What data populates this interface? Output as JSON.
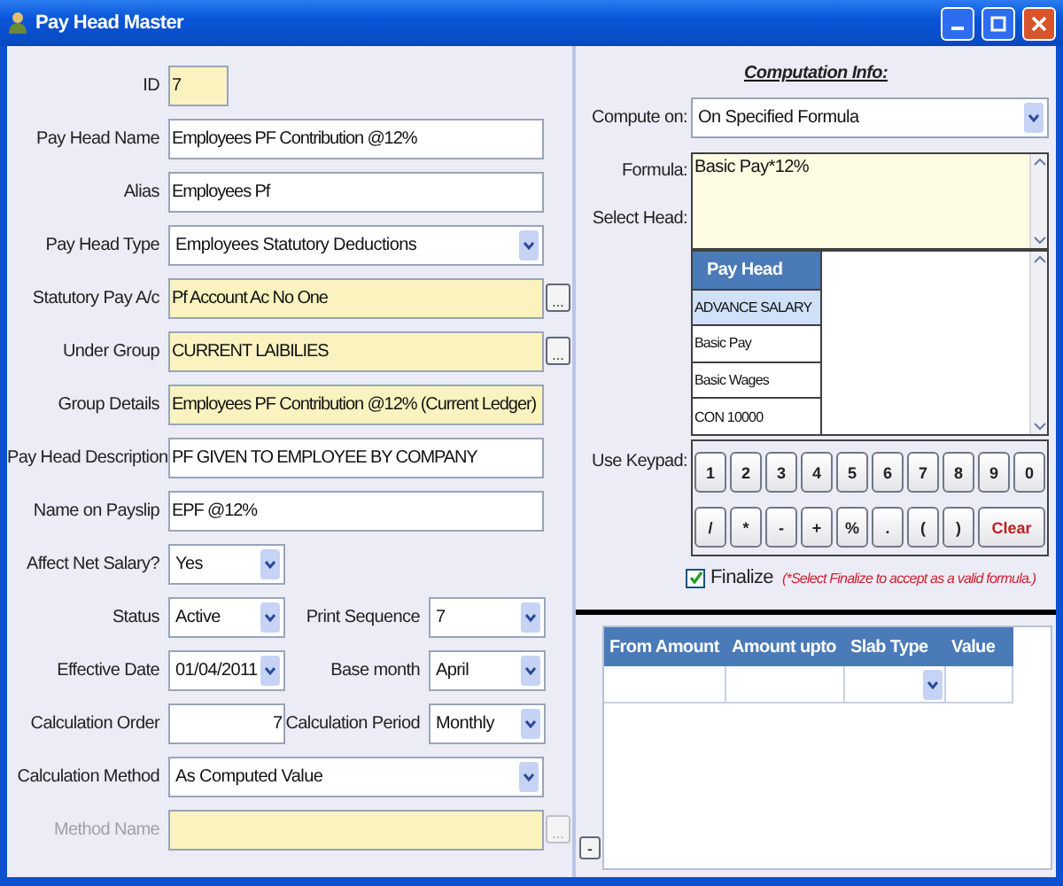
{
  "window": {
    "title": "Pay Head Master"
  },
  "fields": [
    {
      "kind": "short-text",
      "label": "ID",
      "value": "7",
      "highlighted": true
    },
    {
      "kind": "text",
      "label": "Pay Head Name",
      "value": "Employees PF Contribution @12%",
      "highlighted": false
    },
    {
      "kind": "text",
      "label": "Alias",
      "value": "Employees Pf",
      "highlighted": false
    },
    {
      "kind": "select",
      "label": "Pay Head Type",
      "value": "Employees Statutory Deductions",
      "highlighted": false
    },
    {
      "kind": "lookup",
      "label": "Statutory Pay A/c",
      "value": "Pf Account Ac No One",
      "highlighted": true,
      "button": "...",
      "disabled": false
    },
    {
      "kind": "lookup",
      "label": "Under Group",
      "value": "CURRENT LAIBILIES",
      "highlighted": true,
      "button": "...",
      "disabled": false
    },
    {
      "kind": "text",
      "label": "Group Details",
      "value": "Employees PF Contribution @12% (Current Ledger)",
      "highlighted": true
    },
    {
      "kind": "text",
      "label": "Pay Head Description",
      "value": "PF GIVEN TO EMPLOYEE BY COMPANY",
      "highlighted": false
    },
    {
      "kind": "text",
      "label": "Name on Payslip",
      "value": "EPF @12%",
      "highlighted": false
    },
    {
      "kind": "short-select",
      "label": "Affect Net Salary?",
      "value": "Yes",
      "highlighted": false
    },
    {
      "kind": "pair",
      "left": {
        "kind": "short-select",
        "label": "Status",
        "value": "Active"
      },
      "right": {
        "kind": "short-select",
        "label": "Print Sequence",
        "value": "7"
      }
    },
    {
      "kind": "pair",
      "left": {
        "kind": "short-select",
        "label": "Effective Date",
        "value": "01/04/2011"
      },
      "right": {
        "kind": "short-select",
        "label": "Base month",
        "value": "April"
      }
    },
    {
      "kind": "pair",
      "left": {
        "kind": "short-number",
        "label": "Calculation Order",
        "value": "7"
      },
      "right": {
        "kind": "short-select",
        "label": "Calculation Period",
        "value": "Monthly"
      }
    },
    {
      "kind": "select",
      "label": "Calculation Method",
      "value": "As Computed Value",
      "highlighted": false
    },
    {
      "kind": "lookup",
      "label": "Method Name",
      "highlighted": true,
      "button": "...",
      "disabled": true
    }
  ],
  "computation": {
    "heading": "Computation Info:",
    "compute_on": {
      "label": "Compute on:",
      "value": "On Specified Formula"
    },
    "formula": {
      "label": "Formula:",
      "value": "Basic Pay*12%"
    },
    "select_head": {
      "label": "Select Head:",
      "column": "Pay Head",
      "items": [
        {
          "name": "ADVANCE SALARY",
          "selected": true
        },
        {
          "name": "Basic Pay",
          "selected": false
        },
        {
          "name": "Basic Wages",
          "selected": false
        },
        {
          "name": "CON 10000",
          "selected": false
        }
      ]
    },
    "keypad": {
      "label": "Use Keypad:",
      "keys": [
        {
          "label": "1",
          "kind": "key"
        },
        {
          "label": "2",
          "kind": "key"
        },
        {
          "label": "3",
          "kind": "key"
        },
        {
          "label": "4",
          "kind": "key"
        },
        {
          "label": "5",
          "kind": "key"
        },
        {
          "label": "6",
          "kind": "key"
        },
        {
          "label": "7",
          "kind": "key"
        },
        {
          "label": "8",
          "kind": "key"
        },
        {
          "label": "9",
          "kind": "key"
        },
        {
          "label": "0",
          "kind": "key"
        },
        {
          "label": "/",
          "kind": "key"
        },
        {
          "label": "*",
          "kind": "key"
        },
        {
          "label": "-",
          "kind": "key"
        },
        {
          "label": "+",
          "kind": "key"
        },
        {
          "label": "%",
          "kind": "key"
        },
        {
          "label": ".",
          "kind": "key"
        },
        {
          "label": "(",
          "kind": "key"
        },
        {
          "label": ")",
          "kind": "key"
        },
        {
          "label": "Clear",
          "kind": "clear"
        }
      ]
    },
    "finalize": {
      "label": "Finalize",
      "checked": true,
      "note": "(*Select Finalize to accept as a valid formula.)"
    }
  },
  "slabs": {
    "columns": [
      "From Amount",
      "Amount upto",
      "Slab Type",
      "Value"
    ],
    "collapse_button": "-"
  }
}
